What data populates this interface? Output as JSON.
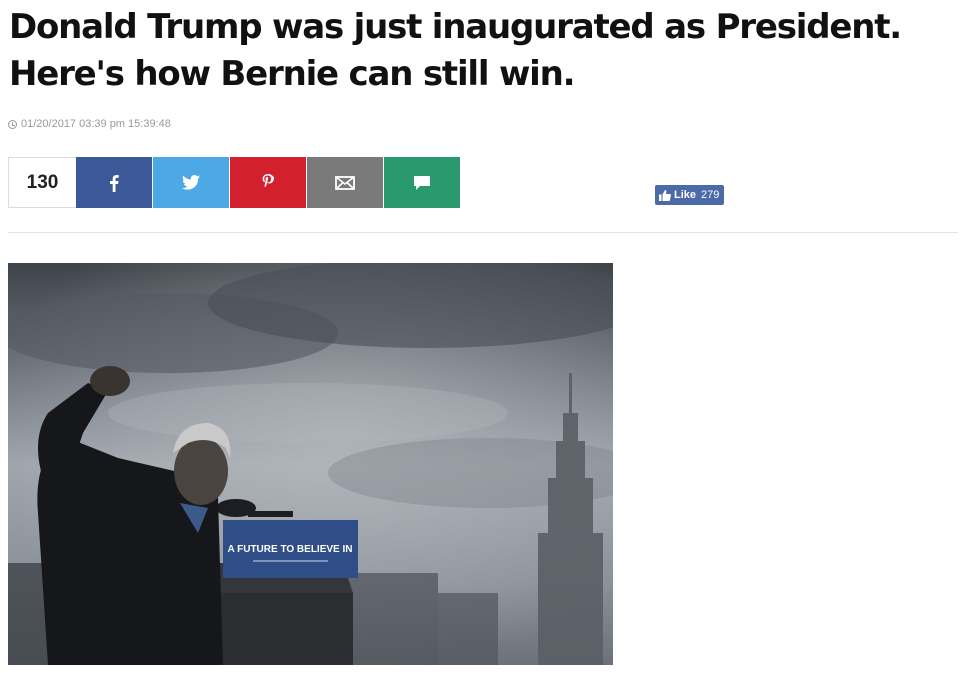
{
  "article": {
    "headline": "Donald Trump was just inaugurated as President. Here's how Bernie can still win.",
    "timestamp": "01/20/2017 03:39 pm 15:39:48"
  },
  "share": {
    "count": "130",
    "buttons": [
      {
        "network": "facebook",
        "icon": "facebook-icon",
        "color": "#3b5998"
      },
      {
        "network": "twitter",
        "icon": "twitter-icon",
        "color": "#4ca9e6"
      },
      {
        "network": "pinterest",
        "icon": "pinterest-icon",
        "color": "#d3202d"
      },
      {
        "network": "email",
        "icon": "envelope-icon",
        "color": "#7a7a7a"
      },
      {
        "network": "comment",
        "icon": "speech-bubble-icon",
        "color": "#2a9a6e"
      }
    ]
  },
  "fb_like": {
    "label": "Like",
    "count": "279",
    "icon": "thumbs-up-icon",
    "color": "#4c69a8"
  },
  "photo": {
    "sign_text": "A FUTURE TO BELIEVE IN"
  }
}
